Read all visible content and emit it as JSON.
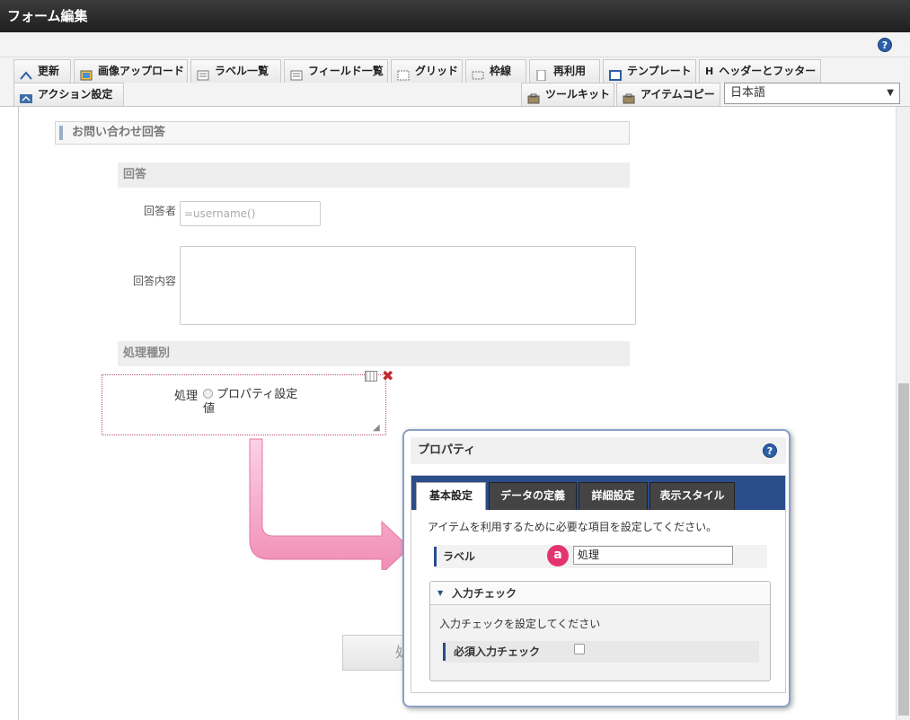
{
  "window": {
    "title": "フォーム編集"
  },
  "toolbar": {
    "update": "更新",
    "image_upload": "画像アップロード",
    "label_list": "ラベル一覧",
    "field_list": "フィールド一覧",
    "grid": "グリッド",
    "frame_lines": "枠線",
    "reuse": "再利用",
    "template": "テンプレート",
    "header_footer": "ヘッダーとフッター",
    "action_settings": "アクション設定",
    "toolkit": "ツールキット",
    "item_copy": "アイテムコピー",
    "language": "日本語",
    "help": "?"
  },
  "form": {
    "section_title": "お問い合わせ回答",
    "answer_head": "回答",
    "respondent_label": "回答者",
    "respondent_placeholder": "=username()",
    "content_label": "回答内容",
    "process_type_head": "処理種別",
    "selected_item": {
      "label_line1": "処理",
      "label_line2": "値",
      "radio_text": "プロパティ設定"
    },
    "hidden_button_text": "処"
  },
  "panel": {
    "title": "プロパティ",
    "help": "?",
    "tabs": [
      "基本設定",
      "データの定義",
      "詳細設定",
      "表示スタイル"
    ],
    "description": "アイテムを利用するために必要な項目を設定してください。",
    "label_field": {
      "label": "ラベル",
      "value": "処理",
      "badge": "a"
    },
    "input_check": {
      "title": "入力チェック",
      "description": "入力チェックを設定してください",
      "required_label": "必須入力チェック",
      "required_checked": false
    }
  },
  "colors": {
    "accent": "#2b4d8a",
    "badge": "#e4346f",
    "arrow": "#f08bb5"
  }
}
